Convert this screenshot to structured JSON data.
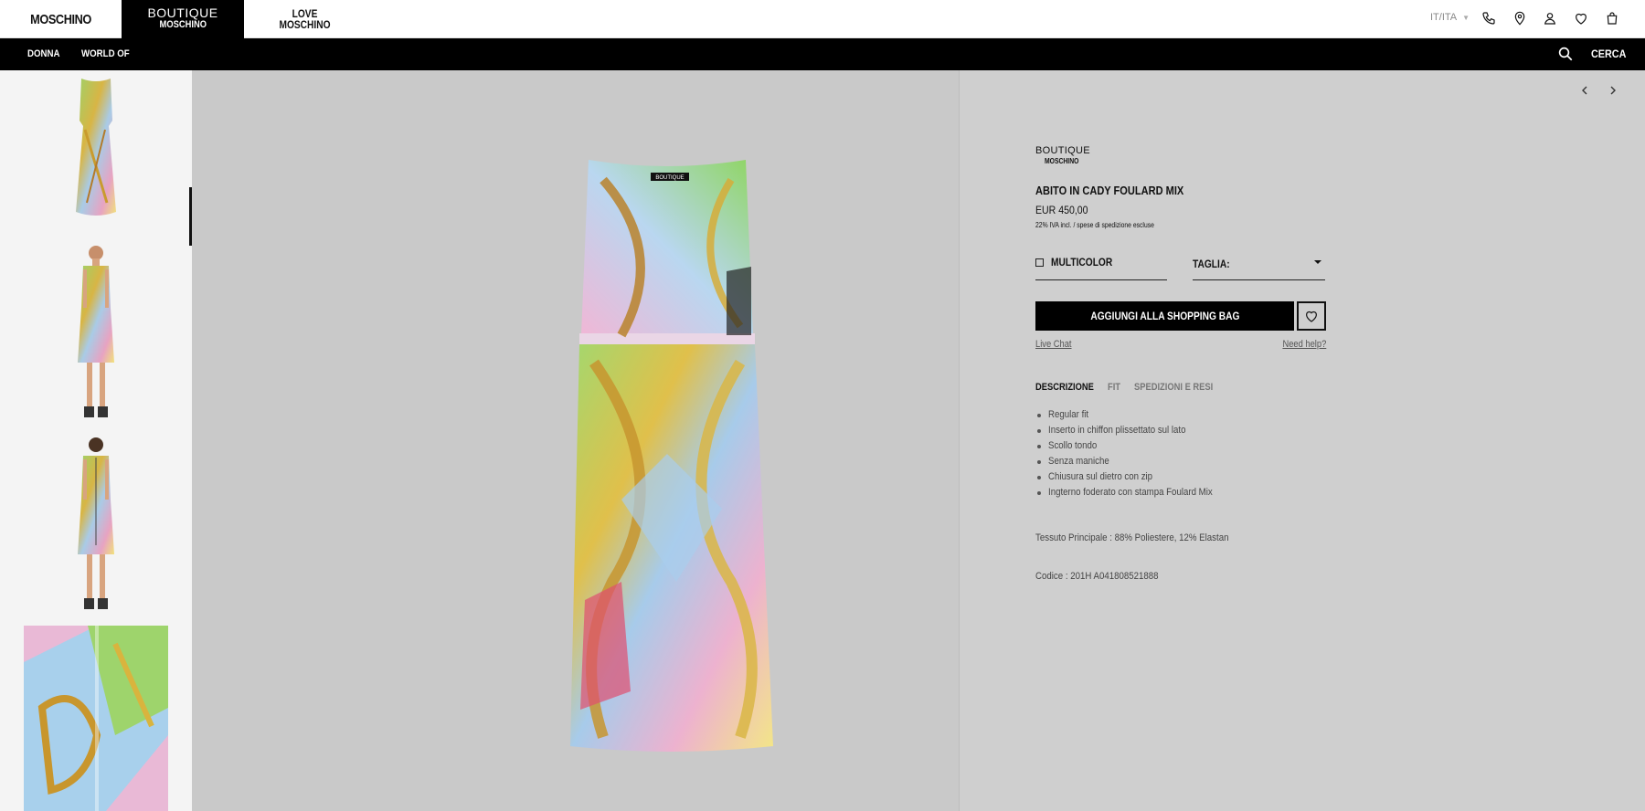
{
  "header": {
    "brands": [
      {
        "label": "MOSCHINO"
      },
      {
        "line1": "BOUTIQUE",
        "line2": "MOSCHINO"
      },
      {
        "line1": "LOVE",
        "line2": "MOSCHINO"
      }
    ],
    "language": "IT/ITA",
    "icons": [
      "phone-icon",
      "location-pin-icon",
      "account-icon",
      "wishlist-heart-icon",
      "shopping-bag-icon"
    ]
  },
  "nav": {
    "items": [
      "DONNA",
      "WORLD OF"
    ],
    "search_label": "CERCA"
  },
  "product": {
    "brand_line1": "BOUTIQUE",
    "brand_line2": "MOSCHINO",
    "title": "ABITO IN CADY FOULARD MIX",
    "price": "EUR  450,00",
    "tax_note": "22% IVA incl. / spese di spedizione escluse",
    "color_label": "MULTICOLOR",
    "size_label": "TAGLIA:",
    "add_to_bag": "AGGIUNGI ALLA SHOPPING BAG",
    "live_chat": "Live Chat",
    "need_help": "Need help?",
    "tabs": [
      "DESCRIZIONE",
      "FIT",
      "SPEDIZIONI E RESI"
    ],
    "active_tab": "DESCRIZIONE",
    "description": [
      "Regular fit",
      "Inserto in chiffon plissettato sul lato",
      "Scollo tondo",
      "Senza maniche",
      "Chiusura sul dietro con zip",
      "Ingterno foderato con stampa Foulard Mix"
    ],
    "fabric": "Tessuto Principale : 88% Poliestere, 12% Elastan",
    "code": "Codice : 201H A041808521888"
  },
  "dress_print_label": "BOUTIQUE",
  "colors": {
    "accent": "#000000",
    "panel_bg": "#cfcfcf",
    "image_bg": "#c9c9c9",
    "thumbs_bg": "#f4f4f4"
  }
}
